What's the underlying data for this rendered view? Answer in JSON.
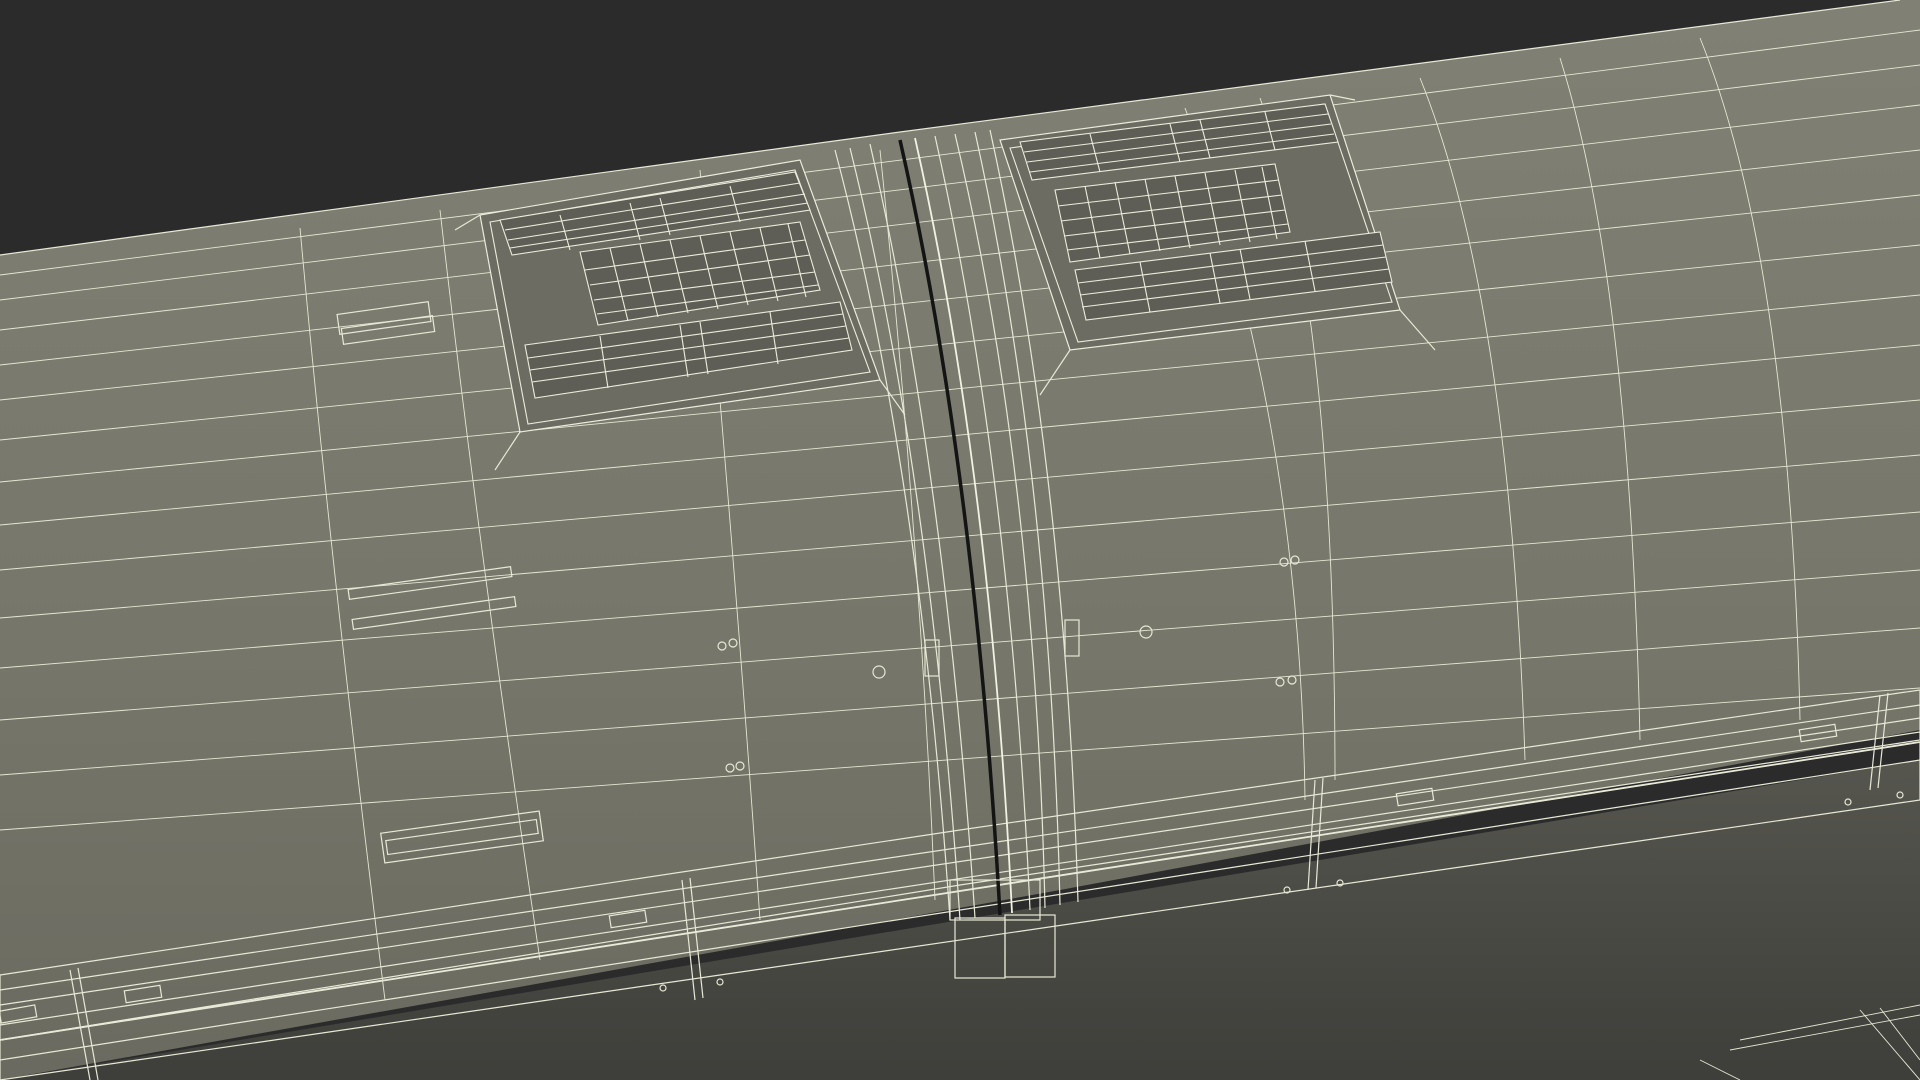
{
  "scene": {
    "subject": "train-car-roof-wireframe",
    "render_mode": "wireframe",
    "background_color": "#2b2b2b",
    "surface_color": "#7a7a6e",
    "shadow_color": "#4e4e48",
    "wire_color": "#e8e8d6",
    "seam_color": "#141414"
  }
}
